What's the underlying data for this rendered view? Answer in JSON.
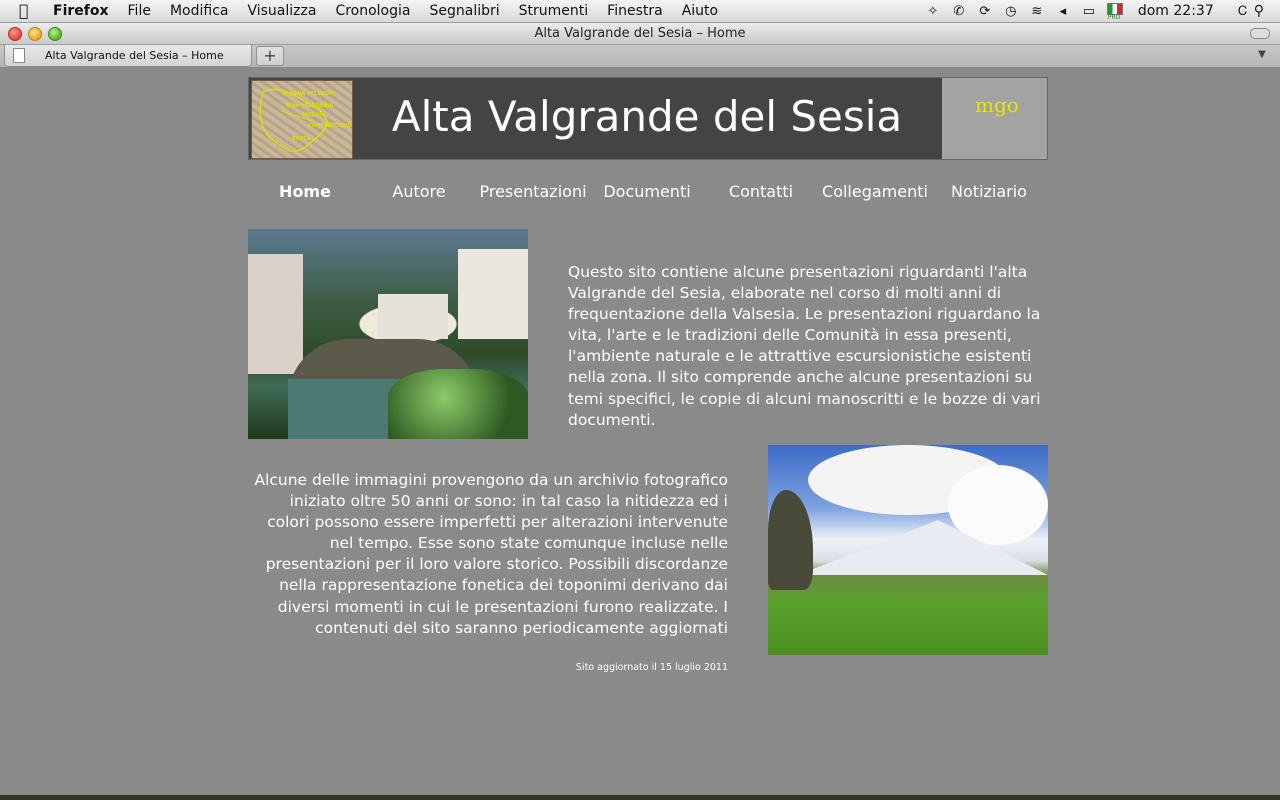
{
  "menubar": {
    "items": [
      "Firefox",
      "File",
      "Modifica",
      "Visualizza",
      "Cronologia",
      "Segnalibri",
      "Strumenti",
      "Finestra",
      "Aiuto"
    ],
    "flag_label": "PRO",
    "clock": "dom 22:37"
  },
  "window": {
    "title": "Alta Valgrande del Sesia – Home",
    "tab_title": "Alta Valgrande del Sesia – Home",
    "new_tab_symbol": "+"
  },
  "banner": {
    "title": "Alta Valgrande del Sesia",
    "map_labels": [
      "ALAGNA VALSESIA",
      "RIVA VALDOBBIA",
      "MOLLIA",
      "CAMPERTOGNO",
      "RASSA"
    ],
    "logo_text": "mgo"
  },
  "nav": {
    "items": [
      "Home",
      "Autore",
      "Presentazioni",
      "Documenti",
      "Contatti",
      "Collegamenti",
      "Notiziario"
    ],
    "active": "Home"
  },
  "content": {
    "paragraph1": "Questo sito contiene alcune presentazioni riguardanti l'alta Valgrande del Sesia, elaborate nel corso di molti anni di frequentazione della Valsesia. Le presentazioni riguardano la vita, l'arte e le tradizioni delle Comunità in essa presenti, l'ambiente naturale e le attrattive escursionistiche esistenti nella zona. Il sito comprende anche alcune presentazioni su temi specifici, le copie di alcuni manoscritti e le bozze di vari documenti.",
    "paragraph2": "Alcune delle immagini provengono da un archivio fotografico iniziato oltre 50 anni or sono: in tal caso la nitidezza ed i colori possono essere imperfetti per alterazioni intervenute nel tempo. Esse sono state comunque incluse nelle presentazioni per il loro valore storico. Possibili discordanze nella rappresentazione fonetica dei toponimi derivano dai diversi momenti in cui le presentazioni furono realizzate. I contenuti del sito saranno periodicamente aggiornati",
    "updated": "Sito aggiornato il 15 luglio 2011"
  },
  "colors": {
    "page_background": "#8a8a8a",
    "banner_background": "#444444",
    "logo_color": "#e6e600",
    "text": "#ffffff"
  }
}
